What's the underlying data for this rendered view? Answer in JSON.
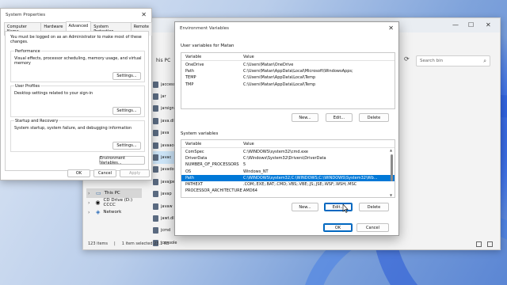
{
  "explorer": {
    "breadcrumb": "his PC",
    "search_placeholder": "Search bin",
    "sidebar": [
      {
        "label": "This PC",
        "selected": true
      },
      {
        "label": "CD Drive (D:) CCCC",
        "selected": false
      },
      {
        "label": "Network",
        "selected": false
      }
    ],
    "files": [
      {
        "name": "jaccess"
      },
      {
        "name": "jar"
      },
      {
        "name": "jarsigner"
      },
      {
        "name": "java.dll"
      },
      {
        "name": "java"
      },
      {
        "name": "javaacce"
      },
      {
        "name": "javac",
        "selected": true
      },
      {
        "name": "javadoc"
      },
      {
        "name": "javajpeg"
      },
      {
        "name": "javap"
      },
      {
        "name": "javaw"
      },
      {
        "name": "jawt.dll"
      },
      {
        "name": "jcmd"
      },
      {
        "name": "jconsole"
      }
    ],
    "status": {
      "items": "123 items",
      "selected": "1 item selected  23.1 KB"
    }
  },
  "system_properties": {
    "title": "System Properties",
    "tabs": [
      "Computer Name",
      "Hardware",
      "Advanced",
      "System Protection",
      "Remote"
    ],
    "active_tab": "Advanced",
    "admin_note": "You must be logged on as an Administrator to make most of these changes.",
    "performance": {
      "title": "Performance",
      "desc": "Visual effects, processor scheduling, memory usage, and virtual memory",
      "button": "Settings..."
    },
    "user_profiles": {
      "title": "User Profiles",
      "desc": "Desktop settings related to your sign-in",
      "button": "Settings..."
    },
    "startup_recovery": {
      "title": "Startup and Recovery",
      "desc": "System startup, system failure, and debugging information",
      "button": "Settings..."
    },
    "env_button": "Environment Variables...",
    "ok": "OK",
    "cancel": "Cancel",
    "apply": "Apply"
  },
  "env_vars": {
    "title": "Environment Variables",
    "user_section": "User variables for Matan",
    "user_header": {
      "variable": "Variable",
      "value": "Value"
    },
    "user_vars": [
      {
        "variable": "OneDrive",
        "value": "C:\\Users\\Matan\\OneDrive"
      },
      {
        "variable": "Path",
        "value": "C:\\Users\\Matan\\AppData\\Local\\Microsoft\\WindowsApps;"
      },
      {
        "variable": "TEMP",
        "value": "C:\\Users\\Matan\\AppData\\Local\\Temp"
      },
      {
        "variable": "TMP",
        "value": "C:\\Users\\Matan\\AppData\\Local\\Temp"
      }
    ],
    "user_buttons": {
      "new": "New...",
      "edit": "Edit...",
      "delete": "Delete"
    },
    "system_section": "System variables",
    "system_header": {
      "variable": "Variable",
      "value": "Value"
    },
    "system_vars": [
      {
        "variable": "ComSpec",
        "value": "C:\\WINDOWS\\system32\\cmd.exe"
      },
      {
        "variable": "DriverData",
        "value": "C:\\Windows\\System32\\Drivers\\DriverData"
      },
      {
        "variable": "NUMBER_OF_PROCESSORS",
        "value": "5"
      },
      {
        "variable": "OS",
        "value": "Windows_NT"
      },
      {
        "variable": "Path",
        "value": "C:\\WINDOWS\\system32;C:\\WINDOWS;C:\\WINDOWS\\System32\\Wb...",
        "selected": true
      },
      {
        "variable": "PATHEXT",
        "value": ".COM;.EXE;.BAT;.CMD;.VBS;.VBE;.JS;.JSE;.WSF;.WSH;.MSC"
      },
      {
        "variable": "PROCESSOR_ARCHITECTURE",
        "value": "AMD64"
      }
    ],
    "system_buttons": {
      "new": "New...",
      "edit": "Edit...",
      "delete": "Delete"
    },
    "ok": "OK",
    "cancel": "Cancel"
  },
  "colors": {
    "accent": "#0078d7",
    "selection": "#0078d7"
  }
}
